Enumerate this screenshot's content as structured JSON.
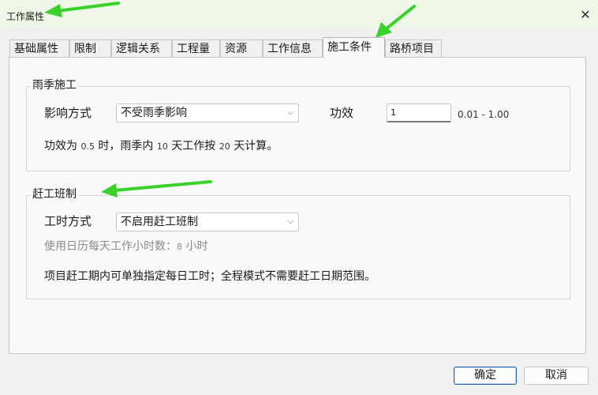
{
  "window": {
    "title": "工作属性"
  },
  "tabs": [
    {
      "label": "基础属性"
    },
    {
      "label": "限制"
    },
    {
      "label": "逻辑关系"
    },
    {
      "label": "工程量"
    },
    {
      "label": "资源"
    },
    {
      "label": "工作信息"
    },
    {
      "label": "施工条件",
      "active": true
    },
    {
      "label": "路桥项目"
    }
  ],
  "rain_group": {
    "title": "雨季施工",
    "mode_label": "影响方式",
    "mode_value": "不受雨季影响",
    "efficiency_label": "功效",
    "efficiency_value": "1",
    "efficiency_range": "0.01 - 1.00",
    "note_a": "功效为 ",
    "note_b": "0.5",
    "note_c": " 时，雨季内 ",
    "note_d": "10",
    "note_e": " 天工作按 ",
    "note_f": "20",
    "note_g": " 天计算。"
  },
  "rush_group": {
    "title": "赶工班制",
    "hours_label": "工时方式",
    "hours_value": "不启用赶工班制",
    "calendar_note_a": "使用日历每天工作小时数：",
    "calendar_note_b": "8",
    "calendar_note_c": " 小时",
    "note": "项目赶工期内可单独指定每日工时；全程模式不需要赶工日期范围。"
  },
  "buttons": {
    "ok": "确定",
    "cancel": "取消"
  },
  "icons": {
    "close": "✕",
    "chevron": "⌵"
  },
  "colors": {
    "annotation_arrow": "#39d12a",
    "primary_border": "#1f5fae"
  }
}
